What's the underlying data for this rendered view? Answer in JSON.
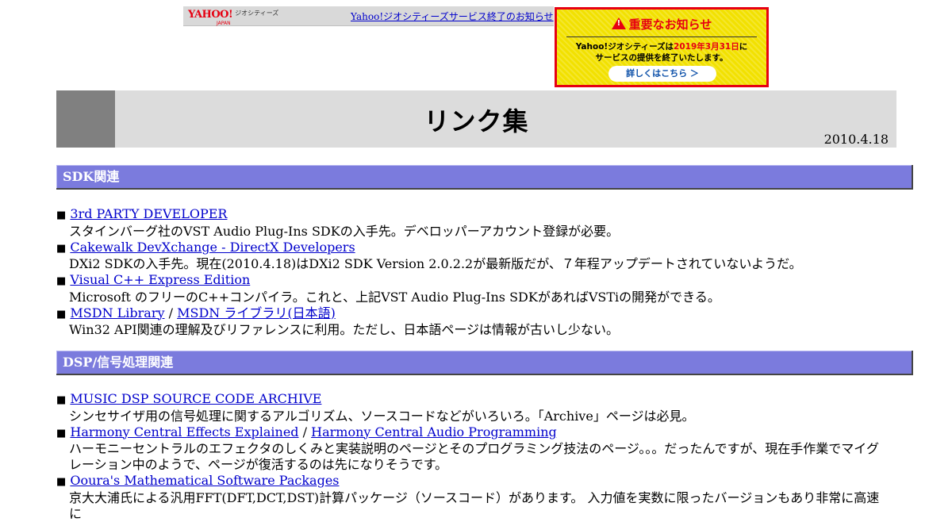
{
  "yahoo_bar": {
    "logo_text": "YAHOO!",
    "logo_sub": "ジオシティーズ",
    "logo_region": "JAPAN",
    "link_text": "Yahoo!ジオシティーズサービス終了のお知らせ"
  },
  "notice": {
    "heading": "重要なお知らせ",
    "body_prefix": "Yahoo!ジオシティーズは",
    "body_date": "2019年3月31日",
    "body_suffix_line1": "に",
    "body_line2": "サービスの提供を終了いたします。",
    "button_label": "詳しくはこちら ＞"
  },
  "header": {
    "title": "リンク集",
    "date": "2010.4.18"
  },
  "bullet": "■",
  "link_separator": "/",
  "sections": [
    {
      "title": "SDK関連",
      "entries": [
        {
          "links": [
            "3rd PARTY DEVELOPER"
          ],
          "desc": "スタインバーグ社のVST Audio Plug-Ins SDKの入手先。デベロッパーアカウント登録が必要。"
        },
        {
          "links": [
            "Cakewalk DevXchange - DirectX Developers"
          ],
          "desc": "DXi2 SDKの入手先。現在(2010.4.18)はDXi2 SDK Version 2.0.2.2が最新版だが、７年程アップデートされていないようだ。"
        },
        {
          "links": [
            "Visual C++ Express Edition"
          ],
          "desc": "Microsoft のフリーのC++コンパイラ。これと、上記VST Audio Plug-Ins SDKがあればVSTiの開発ができる。"
        },
        {
          "links": [
            "MSDN Library",
            "MSDN ライブラリ(日本語)"
          ],
          "desc": "Win32 API関連の理解及びリファレンスに利用。ただし、日本語ページは情報が古いし少ない。"
        }
      ]
    },
    {
      "title": "DSP/信号処理関連",
      "entries": [
        {
          "links": [
            "MUSIC DSP SOURCE CODE ARCHIVE"
          ],
          "desc": "シンセサイザ用の信号処理に関するアルゴリズム、ソースコードなどがいろいろ。「Archive」ページは必見。"
        },
        {
          "links": [
            "Harmony Central Effects Explained",
            "Harmony Central Audio Programming"
          ],
          "desc": "ハーモニーセントラルのエフェクタのしくみと実装説明のページとそのプログラミング技法のページ。。。だったんですが、現在手作業でマイグレーション中のようで、ページが復活するのは先になりそうです。"
        },
        {
          "links": [
            "Ooura's Mathematical Software Packages"
          ],
          "desc": "京大大浦氏による汎用FFT(DFT,DCT,DST)計算パッケージ（ソースコード）があります。 入力値を実数に限ったバージョンもあり非常に高速に"
        }
      ]
    }
  ]
}
